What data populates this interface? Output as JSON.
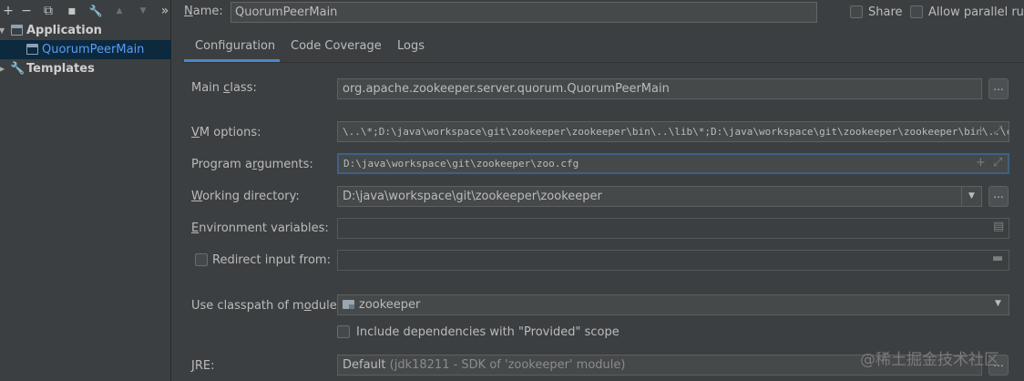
{
  "toolbar": {
    "add": "+",
    "remove": "−",
    "copy": "⧉",
    "save": "▪",
    "edit": "🔧",
    "move_up": "▲",
    "move_down": "▼",
    "more": "»"
  },
  "tree": {
    "application": "Application",
    "config": "QuorumPeerMain",
    "templates": "Templates"
  },
  "header": {
    "name_label": "Name:",
    "name_value": "QuorumPeerMain",
    "share_label": "Share",
    "share_checked": false,
    "parallel_label": "Allow parallel run",
    "parallel_checked": false
  },
  "tabs": [
    "Configuration",
    "Code Coverage",
    "Logs"
  ],
  "active_tab": "Configuration",
  "form": {
    "main_class_label": "Main class:",
    "main_class_value": "org.apache.zookeeper.server.quorum.QuorumPeerMain",
    "vm_options_label": "VM options:",
    "vm_options_value": "\\..\\*;D:\\java\\workspace\\git\\zookeeper\\zookeeper\\bin\\..\\lib\\*;D:\\java\\workspace\\git\\zookeeper\\zookeeper\\bin\\..\\conf\"",
    "program_args_label": "Program arguments:",
    "program_args_value": "D:\\java\\workspace\\git\\zookeeper\\zoo.cfg",
    "working_dir_label": "Working directory:",
    "working_dir_value": "D:\\java\\workspace\\git\\zookeeper\\zookeeper",
    "env_vars_label": "Environment variables:",
    "env_vars_value": "",
    "redirect_label": "Redirect input from:",
    "redirect_checked": false,
    "redirect_value": "",
    "classpath_label": "Use classpath of module:",
    "classpath_value": "zookeeper",
    "include_deps_label": "Include dependencies with \"Provided\" scope",
    "include_deps_checked": false,
    "jre_label": "JRE:",
    "jre_value_main": "Default",
    "jre_value_detail": "(jdk18211 - SDK of 'zookeeper' module)",
    "browse_label": "..."
  },
  "watermark": "@稀土掘金技术社区",
  "colors": {
    "background": "#3c3f41",
    "field": "#45494a",
    "selection": "#0d293e",
    "accent": "#4a88c7",
    "text": "#bbbbbb"
  }
}
